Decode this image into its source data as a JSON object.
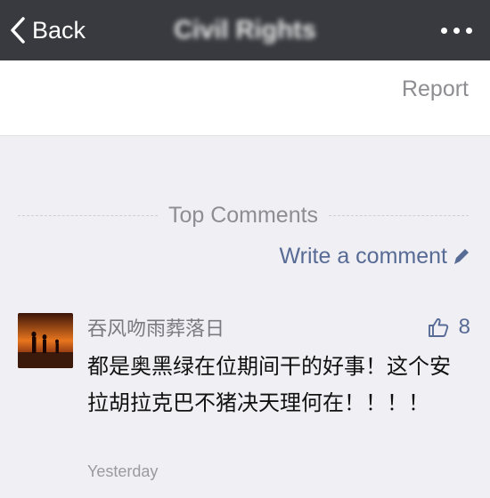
{
  "navbar": {
    "back_label": "Back",
    "title": "Civil Rights",
    "more_icon": "more-dots-icon"
  },
  "report_label": "Report",
  "comments_section": {
    "heading": "Top Comments",
    "write_label": "Write a comment",
    "write_icon": "pencil-icon"
  },
  "comment": {
    "nickname": "吞风吻雨葬落日",
    "like_count": "8",
    "like_icon": "thumbs-up-icon",
    "text": "都是奥黑绿在位期间干的好事！这个安拉胡拉克巴不猪决天理何在！！！！",
    "time": "Yesterday"
  },
  "colors": {
    "navbar": "#393a3f",
    "link": "#576b95",
    "muted": "#8d8d92",
    "background": "#efeff4"
  }
}
